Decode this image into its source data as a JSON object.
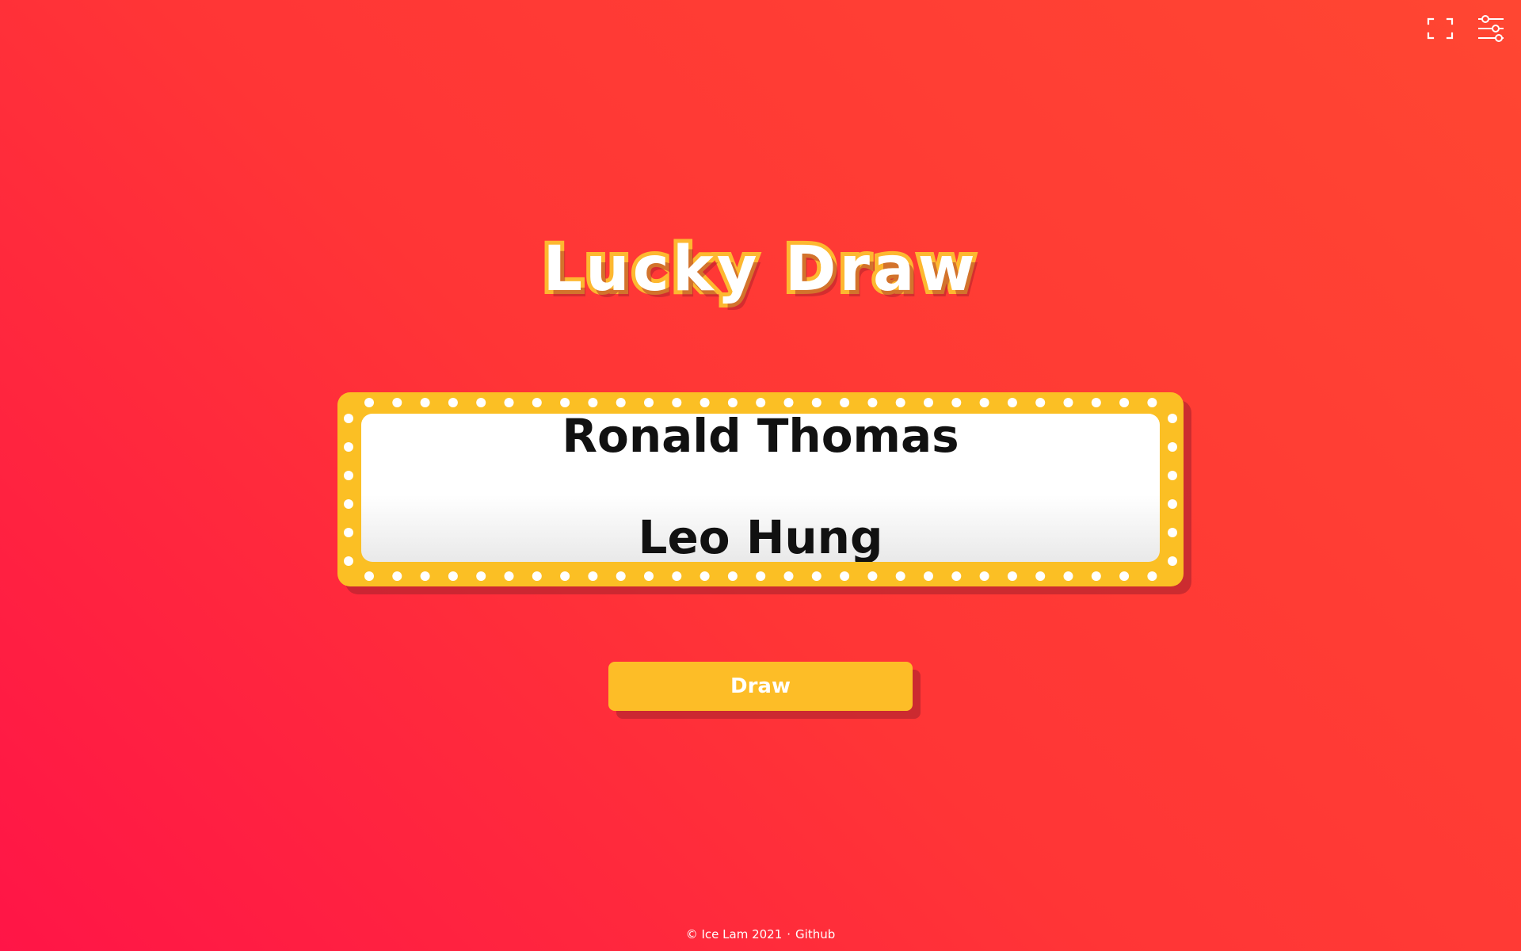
{
  "toolbar": {
    "fullscreen_icon": "fullscreen-icon",
    "settings_icon": "settings-sliders-icon"
  },
  "title": "Lucky Draw",
  "board": {
    "names": [
      "Ronald Thomas",
      "Leo Hung"
    ]
  },
  "draw_button": {
    "label": "Draw"
  },
  "footer": {
    "copyright": "© Ice Lam 2021",
    "separator": "·",
    "link_label": "Github"
  },
  "colors": {
    "background_start": "#ff1547",
    "background_end": "#ff4632",
    "accent_yellow": "#fbbf24",
    "text_dark": "#111111",
    "white": "#ffffff"
  }
}
